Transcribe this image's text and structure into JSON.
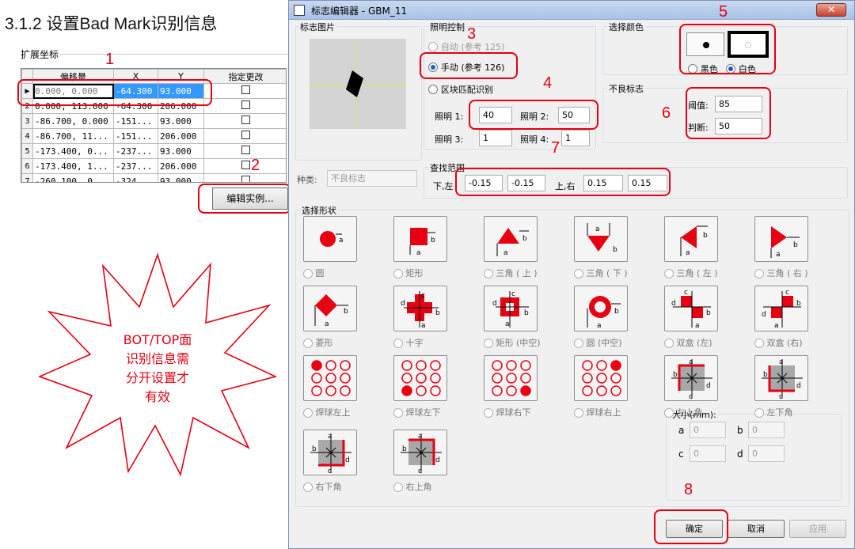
{
  "doc": {
    "heading": "3.1.2 设置Bad Mark识别信息",
    "group_title": "扩展坐标",
    "grid": {
      "headers": [
        "偏移量",
        "X",
        "Y",
        "指定更改"
      ],
      "rows": [
        {
          "idx": "",
          "offset": "0.000, 0.000",
          "x": "-64.300",
          "y": "93.000"
        },
        {
          "idx": "2",
          "offset": "0.000, 113.000",
          "x": "-64.300",
          "y": "206.000"
        },
        {
          "idx": "3",
          "offset": "-86.700, 0.000",
          "x": "-151...",
          "y": "93.000"
        },
        {
          "idx": "4",
          "offset": "-86.700, 11...",
          "x": "-151...",
          "y": "206.000"
        },
        {
          "idx": "5",
          "offset": "-173.400, 0...",
          "x": "-237...",
          "y": "93.000"
        },
        {
          "idx": "6",
          "offset": "-173.400, 1...",
          "x": "-237...",
          "y": "206.000"
        },
        {
          "idx": "7",
          "offset": "-260.100, 0...",
          "x": "-324...",
          "y": "93.000"
        }
      ]
    },
    "edit_button": "编辑实例...",
    "callout": "BOT/TOP面\n识别信息需\n分开设置才\n有效"
  },
  "annotations": [
    "1",
    "2",
    "3",
    "4",
    "5",
    "6",
    "7",
    "8"
  ],
  "dialog": {
    "title": "标志编辑器 - GBM_11",
    "close": "✕",
    "image_group": "标志图片",
    "kind_label": "种类:",
    "kind_value": "不良标志",
    "lighting": {
      "title": "照明控制",
      "auto": "自动 (参考 125)",
      "manual": "手动 (参考 126)",
      "block": "区块匹配识别",
      "l1_label": "照明 1:",
      "l1": "40",
      "l2_label": "照明 2:",
      "l2": "50",
      "l3_label": "照明 3:",
      "l3": "1",
      "l4_label": "照明 4:",
      "l4": "1"
    },
    "color": {
      "title": "选择颜色",
      "black": "黑色",
      "white": "白色"
    },
    "bad_mark": {
      "title": "不良标志",
      "threshold_label": "阈值:",
      "threshold": "85",
      "judge_label": "判断:",
      "judge": "50"
    },
    "search": {
      "title": "查找范围",
      "lower_left_label": "下,左",
      "ll1": "-0.15",
      "ll2": "-0.15",
      "upper_right_label": "上,右",
      "ur1": "0.15",
      "ur2": "0.15"
    },
    "shapes_title": "选择形状",
    "shapes": [
      "圆",
      "矩形",
      "三角 ( 上 )",
      "三角 ( 下 )",
      "三角 ( 左 )",
      "三角 ( 右 )",
      "菱形",
      "十字",
      "矩形 (中空)",
      "圆 (中空)",
      "双盒 (左)",
      "双盒 (右)",
      "焊球左上",
      "焊球左下",
      "焊球右下",
      "焊球右上",
      "左上角",
      "左下角",
      "右下角",
      "右上角"
    ],
    "size": {
      "title": "大小(mm):",
      "a_label": "a",
      "a": "0",
      "b_label": "b",
      "b": "0",
      "c_label": "c",
      "c": "0",
      "d_label": "d",
      "d": "0"
    },
    "ok": "确定",
    "cancel": "取消",
    "apply": "应用"
  },
  "colors": {
    "annotation": "#e60012",
    "selection": "#3399ff"
  }
}
